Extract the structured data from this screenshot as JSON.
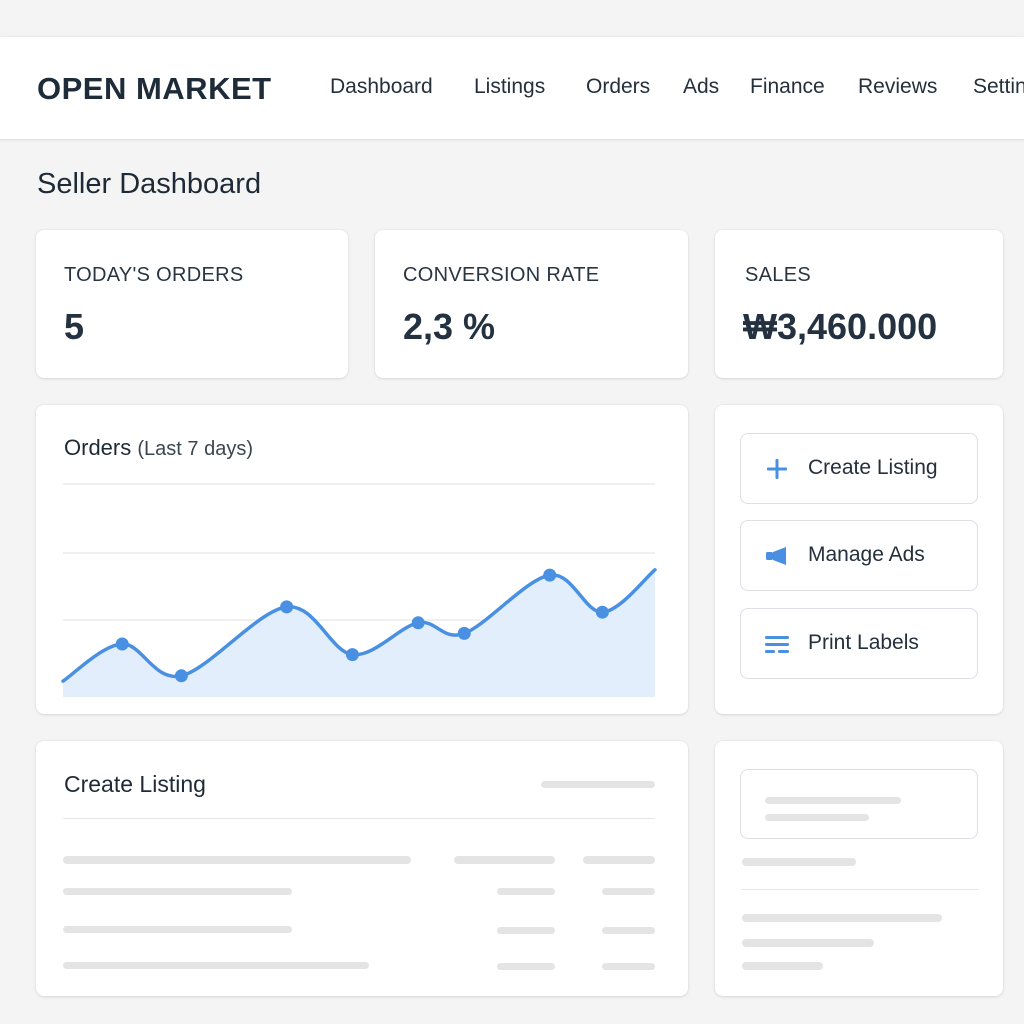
{
  "header": {
    "brand": "OPEN MARKET",
    "nav": [
      "Dashboard",
      "Listings",
      "Orders",
      "Ads",
      "Finance",
      "Reviews",
      "Settings"
    ]
  },
  "page": {
    "title": "Seller Dashboard"
  },
  "stats": [
    {
      "label": "TODAY'S ORDERS",
      "value": "5"
    },
    {
      "label": "CONVERSION RATE",
      "value": "2,3 %"
    },
    {
      "label": "SALES",
      "value": "₩3,460.000"
    }
  ],
  "orders_chart": {
    "title": "Orders",
    "subtitle": "(Last 7 days)"
  },
  "chart_data": {
    "type": "area",
    "title": "Orders (Last 7 days)",
    "xlabel": "",
    "ylabel": "",
    "grid": true,
    "ylim": [
      0,
      4
    ],
    "x": [
      0,
      1,
      2,
      3,
      4,
      5,
      6,
      7,
      8,
      9,
      10
    ],
    "values": [
      0.3,
      1.0,
      0.4,
      1.7,
      0.8,
      1.4,
      1.2,
      2.3,
      1.6,
      2.4
    ],
    "series": [
      {
        "x": [
          0,
          0.9,
          1.8,
          3.4,
          4.4,
          5.4,
          6.1,
          7.4,
          8.2,
          9.0
        ],
        "values": [
          0.3,
          1.0,
          0.4,
          1.7,
          0.8,
          1.4,
          1.2,
          2.3,
          1.6,
          2.4
        ]
      }
    ],
    "colors": {
      "line": "#4a90e2",
      "fill": "#e3eefc"
    }
  },
  "actions": [
    {
      "label": "Create Listing",
      "icon": "plus-icon"
    },
    {
      "label": "Manage Ads",
      "icon": "megaphone-icon"
    },
    {
      "label": "Print Labels",
      "icon": "list-icon"
    }
  ],
  "listing": {
    "title": "Create Listing"
  },
  "colors": {
    "accent": "#4a90e2",
    "placeholder": "#e4e4e4"
  }
}
